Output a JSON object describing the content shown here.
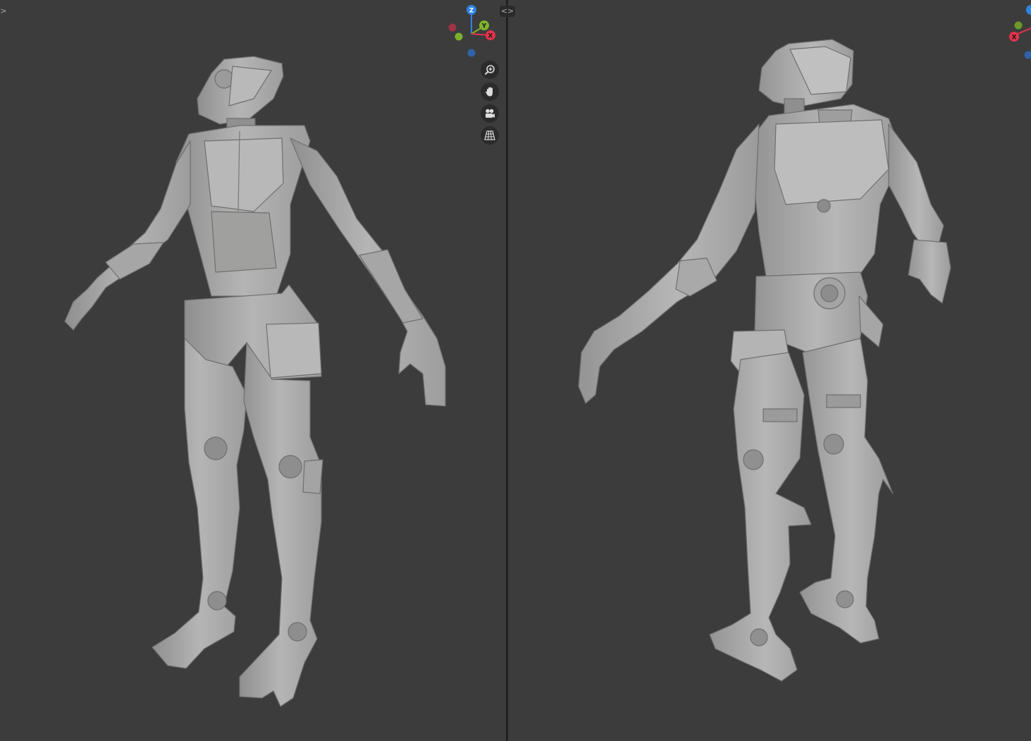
{
  "viewports": {
    "left": {
      "gizmo": {
        "z_label": "Z",
        "y_label": "Y",
        "x_label": "X"
      },
      "tools": [
        "zoom-icon",
        "hand-pan-icon",
        "camera-icon",
        "grid-perspective-icon"
      ]
    },
    "right": {
      "gizmo": {
        "x_label": "X"
      }
    }
  },
  "colors": {
    "viewport_bg": "#3c3c3c",
    "model_base": "#a9aaa9",
    "axis_x": "#e5334b",
    "axis_y": "#7fb32a",
    "axis_z": "#2f83e2"
  },
  "controls": {
    "edge_toggle_left": ">",
    "split_handle": "<>"
  }
}
